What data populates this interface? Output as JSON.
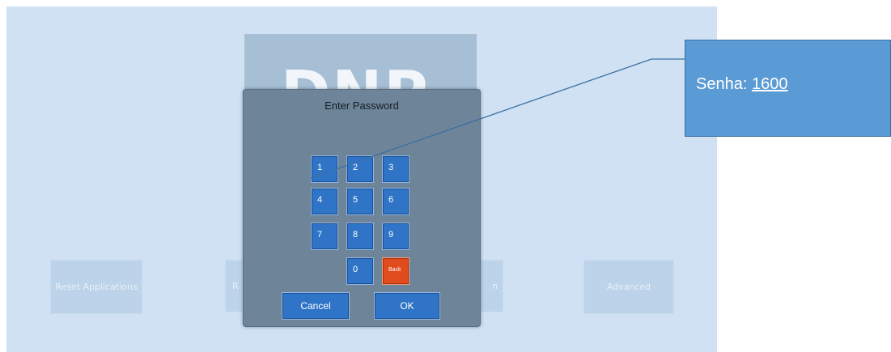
{
  "logo": {
    "text": "DNP"
  },
  "background_buttons": [
    {
      "label": "Reset Applications"
    },
    {
      "label": "R"
    },
    {
      "label": "n"
    },
    {
      "label": "Advanced"
    }
  ],
  "dialog": {
    "title": "Enter Password",
    "keys": {
      "k1": "1",
      "k2": "2",
      "k3": "3",
      "k4": "4",
      "k5": "5",
      "k6": "6",
      "k7": "7",
      "k8": "8",
      "k9": "9",
      "k0": "0",
      "back": "Back"
    },
    "cancel_label": "Cancel",
    "ok_label": "OK"
  },
  "callout": {
    "label": "Senha:",
    "value": "1600"
  },
  "colors": {
    "screen_bg": "#cfe1f3",
    "dialog_bg": "#6e8599",
    "key_blue": "#2f74c6",
    "back_key": "#e14c1e",
    "callout_bg": "#5b9bd5"
  }
}
